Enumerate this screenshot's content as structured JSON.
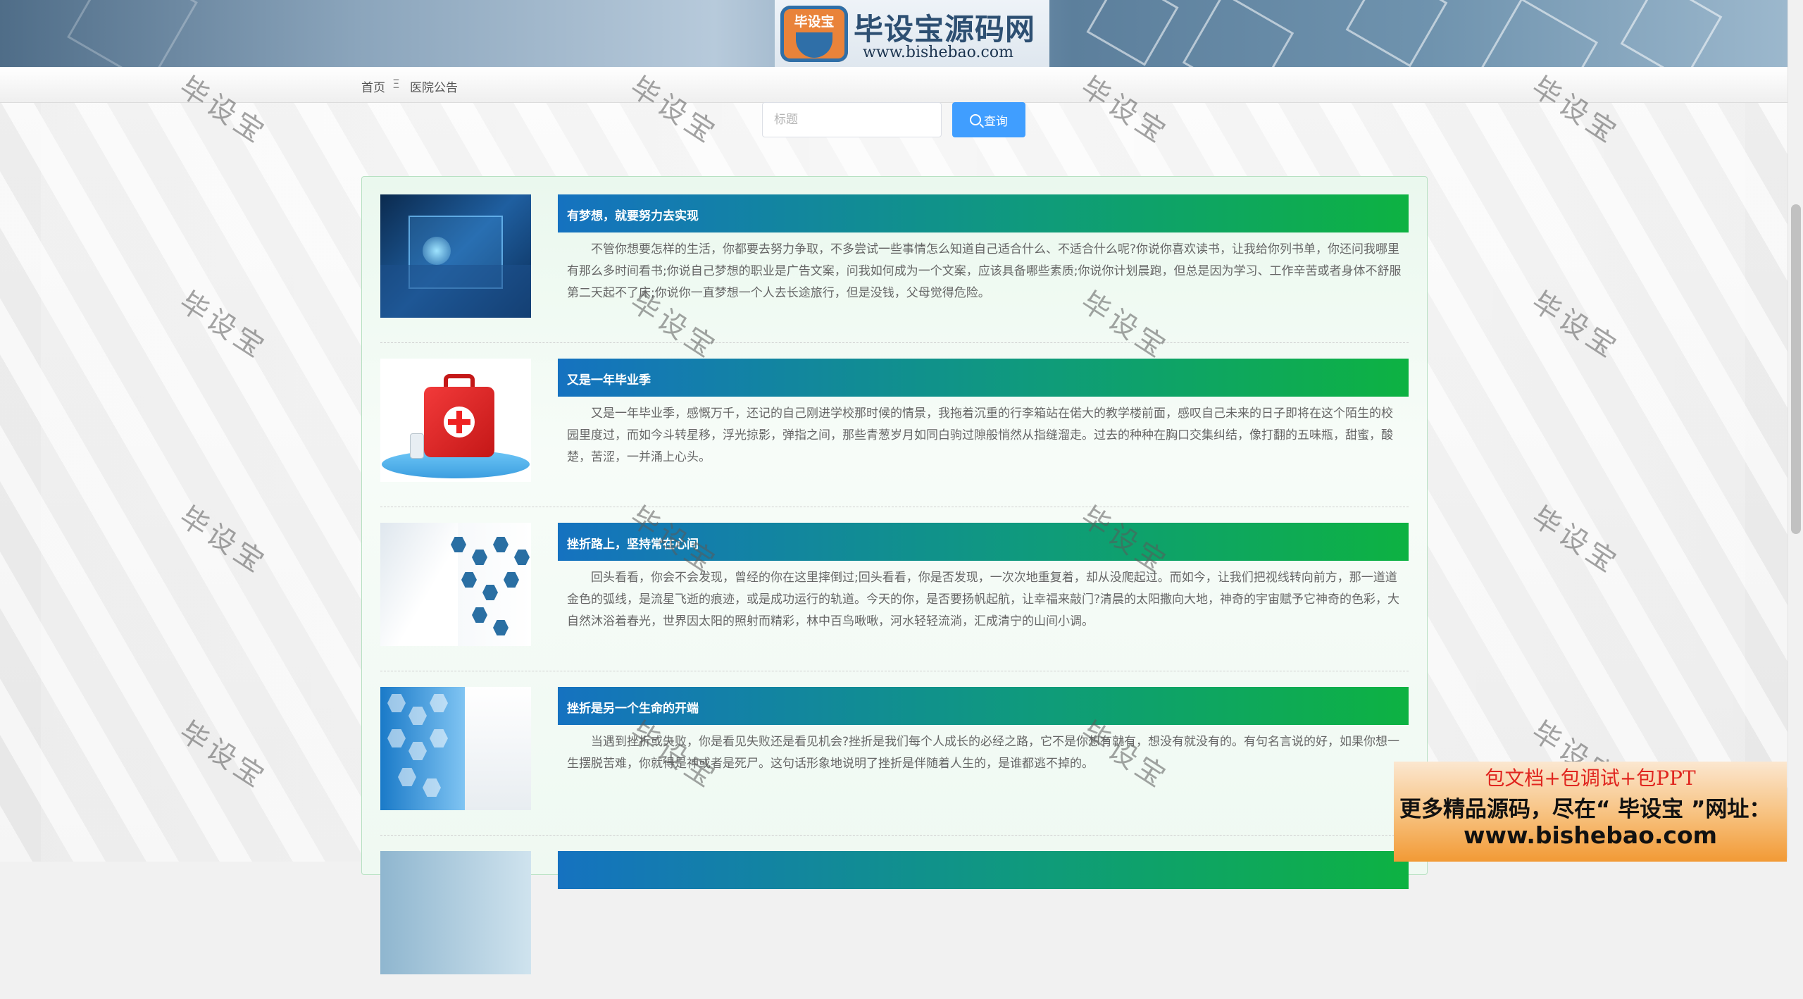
{
  "header": {
    "logo_badge": "毕设宝",
    "logo_title": "毕设宝源码网",
    "logo_url": "www.bishebao.com"
  },
  "breadcrumb": {
    "home": "首页",
    "separator": "Ξ",
    "current": "医院公告"
  },
  "search": {
    "placeholder": "标题",
    "value": "",
    "button_label": "查询"
  },
  "notices": [
    {
      "title": "有梦想，就要努力去实现",
      "summary": "不管你想要怎样的生活，你都要去努力争取，不多尝试一些事情怎么知道自己适合什么、不适合什么呢?你说你喜欢读书，让我给你列书单，你还问我哪里有那么多时间看书;你说自己梦想的职业是广告文案，问我如何成为一个文案，应该具备哪些素质;你说你计划晨跑，但总是因为学习、工作辛苦或者身体不舒服第二天起不了床;你说你一直梦想一个人去长途旅行，但是没钱，父母觉得危险。"
    },
    {
      "title": "又是一年毕业季",
      "summary": "又是一年毕业季，感慨万千，还记的自己刚进学校那时候的情景，我拖着沉重的行李箱站在偌大的教学楼前面，感叹自己未来的日子即将在这个陌生的校园里度过，而如今斗转星移，浮光掠影，弹指之间，那些青葱岁月如同白驹过隙般悄然从指缝溜走。过去的种种在胸口交集纠结，像打翻的五味瓶，甜蜜，酸楚，苦涩，一并涌上心头。"
    },
    {
      "title": "挫折路上，坚持常在心间",
      "summary": "回头看看，你会不会发现，曾经的你在这里摔倒过;回头看看，你是否发现，一次次地重复着，却从没爬起过。而如今，让我们把视线转向前方，那一道道金色的弧线，是流星飞逝的痕迹，或是成功运行的轨道。今天的你，是否要扬帆起航，让幸福来敲门?清晨的太阳撒向大地，神奇的宇宙赋予它神奇的色彩，大自然沐浴着春光，世界因太阳的照射而精彩，林中百鸟啾啾，河水轻轻流淌，汇成清宁的山间小调。"
    },
    {
      "title": "挫折是另一个生命的开端",
      "summary": "当遇到挫折或失败，你是看见失败还是看见机会?挫折是我们每个人成长的必经之路，它不是你想有就有，想没有就没有的。有句名言说的好，如果你想一生摆脱苦难，你就得是神或者是死尸。这句话形象地说明了挫折是伴随着人生的，是谁都逃不掉的。"
    }
  ],
  "watermark_text": "毕设宝",
  "promo": {
    "line1": "包文档+包调试+包PPT",
    "line2": "更多精品源码，尽在“ 毕设宝 ”网址：",
    "line3": "www.bishebao.com"
  }
}
